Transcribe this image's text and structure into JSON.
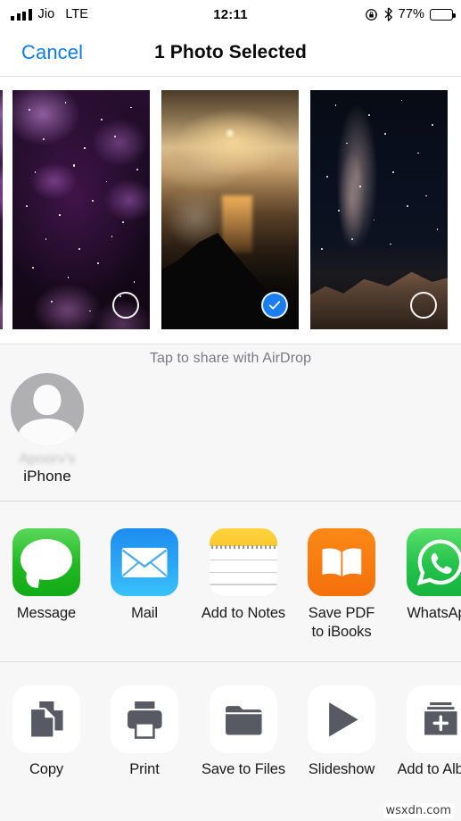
{
  "status_bar": {
    "carrier": "Jio",
    "network": "LTE",
    "time": "12:11",
    "battery_percent": "77%",
    "battery_level": 77,
    "rotation_lock_icon": "rotation-lock-icon",
    "bluetooth_icon": "bluetooth-icon",
    "signal_icon": "signal-bars-icon"
  },
  "navbar": {
    "cancel_label": "Cancel",
    "title": "1 Photo Selected",
    "cancel_color": "#0b7cf5"
  },
  "photos": [
    {
      "name": "purple-nebula",
      "selected": false,
      "alt": "Purple nebula starfield"
    },
    {
      "name": "sunset-clouds-peak",
      "selected": true,
      "alt": "Golden clouds and sun over dark mountain peak"
    },
    {
      "name": "milky-way-ridge",
      "selected": false,
      "alt": "Milky way over snowy mountain ridge"
    }
  ],
  "airdrop": {
    "hint": "Tap to share with AirDrop",
    "contact_name_blurred": "Apoorv's",
    "contact_device": "iPhone",
    "avatar_icon": "person-avatar-icon"
  },
  "apps": [
    {
      "label": "Message",
      "icon": "message-bubble-icon",
      "color": "#21b821"
    },
    {
      "label": "Mail",
      "icon": "mail-envelope-icon",
      "color": "#2ba4f5"
    },
    {
      "label": "Add to Notes",
      "icon": "notes-icon",
      "color": "#fdd33d"
    },
    {
      "label": "Save PDF\nto iBooks",
      "label_line1": "Save PDF",
      "label_line2": "to iBooks",
      "icon": "ibooks-book-icon",
      "color": "#f4700b"
    },
    {
      "label": "WhatsApp",
      "icon": "whatsapp-icon",
      "color": "#23c24a"
    }
  ],
  "actions": [
    {
      "label": "Copy",
      "icon": "copy-pages-icon"
    },
    {
      "label": "Print",
      "icon": "printer-icon"
    },
    {
      "label": "Save to Files",
      "icon": "folder-icon"
    },
    {
      "label": "Slideshow",
      "icon": "play-triangle-icon"
    },
    {
      "label": "Add to Album",
      "icon": "add-to-album-icon"
    }
  ],
  "watermark": "wsxdn.com",
  "accent_colors": {
    "ios_blue": "#0b7cf5",
    "selection_blue": "#1b7ef0",
    "section_bg": "#f7f7f7",
    "action_glyph": "#575a63"
  }
}
